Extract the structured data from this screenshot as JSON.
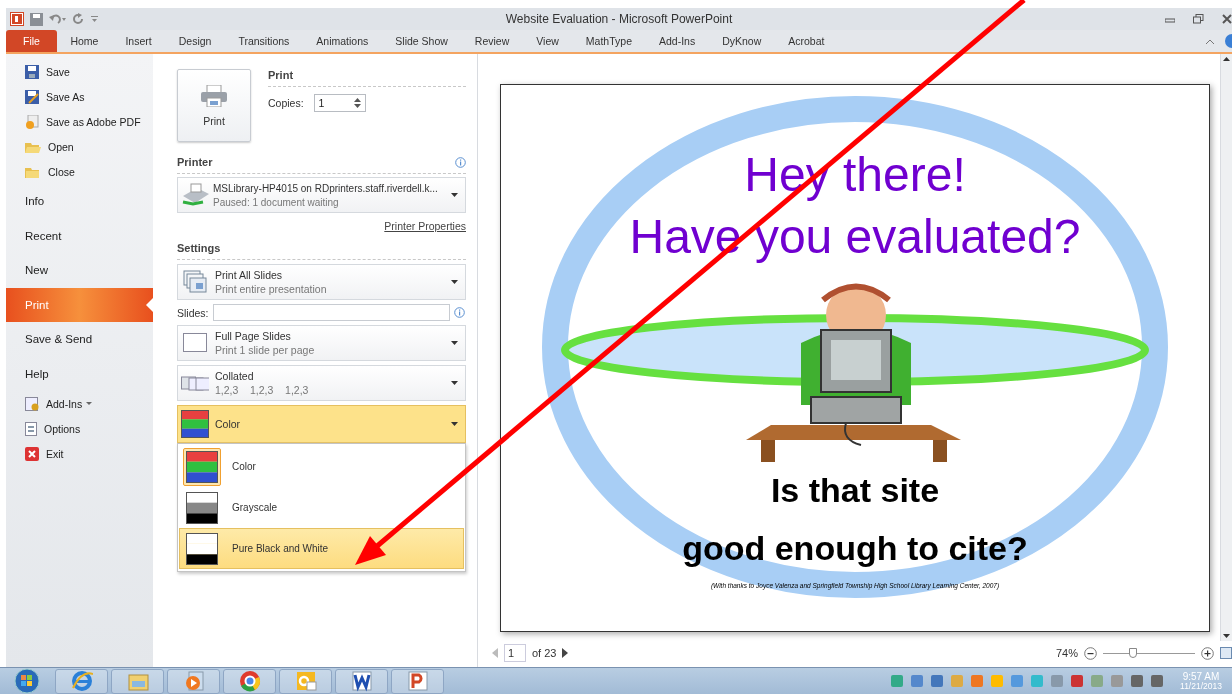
{
  "window": {
    "title": "Website Evaluation - Microsoft PowerPoint"
  },
  "ribbon_tabs": [
    {
      "label": "File",
      "selected": true
    },
    {
      "label": "Home",
      "selected": false
    },
    {
      "label": "Insert",
      "selected": false
    },
    {
      "label": "Design",
      "selected": false
    },
    {
      "label": "Transitions",
      "selected": false
    },
    {
      "label": "Animations",
      "selected": false
    },
    {
      "label": "Slide Show",
      "selected": false
    },
    {
      "label": "Review",
      "selected": false
    },
    {
      "label": "View",
      "selected": false
    },
    {
      "label": "MathType",
      "selected": false
    },
    {
      "label": "Add-Ins",
      "selected": false
    },
    {
      "label": "DyKnow",
      "selected": false
    },
    {
      "label": "Acrobat",
      "selected": false
    }
  ],
  "backstage_menu": [
    {
      "label": "Save",
      "kind": "save"
    },
    {
      "label": "Save As",
      "kind": "saveas"
    },
    {
      "label": "Save as Adobe PDF",
      "kind": "pdf"
    },
    {
      "label": "Open",
      "kind": "open"
    },
    {
      "label": "Close",
      "kind": "close"
    },
    {
      "label": "Info",
      "kind": "section",
      "selected": false
    },
    {
      "label": "Recent",
      "kind": "section",
      "selected": false
    },
    {
      "label": "New",
      "kind": "section",
      "selected": false
    },
    {
      "label": "Print",
      "kind": "section",
      "selected": true
    },
    {
      "label": "Save & Send",
      "kind": "section",
      "selected": false
    },
    {
      "label": "Help",
      "kind": "section",
      "selected": false
    },
    {
      "label": "Add-Ins",
      "kind": "addins"
    },
    {
      "label": "Options",
      "kind": "options"
    },
    {
      "label": "Exit",
      "kind": "exit"
    }
  ],
  "print": {
    "heading": "Print",
    "button": "Print",
    "copies_label": "Copies:",
    "copies": "1"
  },
  "printer": {
    "heading": "Printer",
    "name": "MSLibrary-HP4015 on RDprinters.staff.riverdell.k...",
    "status": "Paused: 1 document waiting",
    "properties_link": "Printer Properties"
  },
  "settings": {
    "heading": "Settings",
    "slides_label": "Slides:",
    "dropdowns": [
      {
        "kind": "range",
        "title": "Print All Slides",
        "subtitle": "Print entire presentation",
        "expanded": false
      },
      {
        "kind": "layout",
        "title": "Full Page Slides",
        "subtitle": "Print 1 slide per page",
        "expanded": false
      },
      {
        "kind": "collate",
        "title": "Collated",
        "subtitle": "1,2,3    1,2,3    1,2,3",
        "expanded": false
      },
      {
        "kind": "color",
        "title": "Color",
        "expanded": true
      }
    ],
    "color_options": [
      {
        "kind": "color",
        "label": "Color",
        "checked": true,
        "selected": false
      },
      {
        "kind": "grayscale",
        "label": "Grayscale",
        "checked": false,
        "selected": false
      },
      {
        "kind": "bw",
        "label": "Pure Black and White",
        "checked": false,
        "selected": true
      }
    ]
  },
  "slide": {
    "title_lines": [
      "Hey there!",
      "Have you evaluated?"
    ],
    "question_lines": [
      "Is that site",
      "good enough to cite?"
    ],
    "credit": "(With thanks to Joyce Valenza and Springfield Township High School Library Learning Center, 2007)"
  },
  "preview_nav": {
    "page": "1",
    "page_count": "of 23",
    "zoom": "74%",
    "level": 0.33
  },
  "taskbar": {
    "time": "9:57 AM",
    "date": "11/21/2013"
  }
}
